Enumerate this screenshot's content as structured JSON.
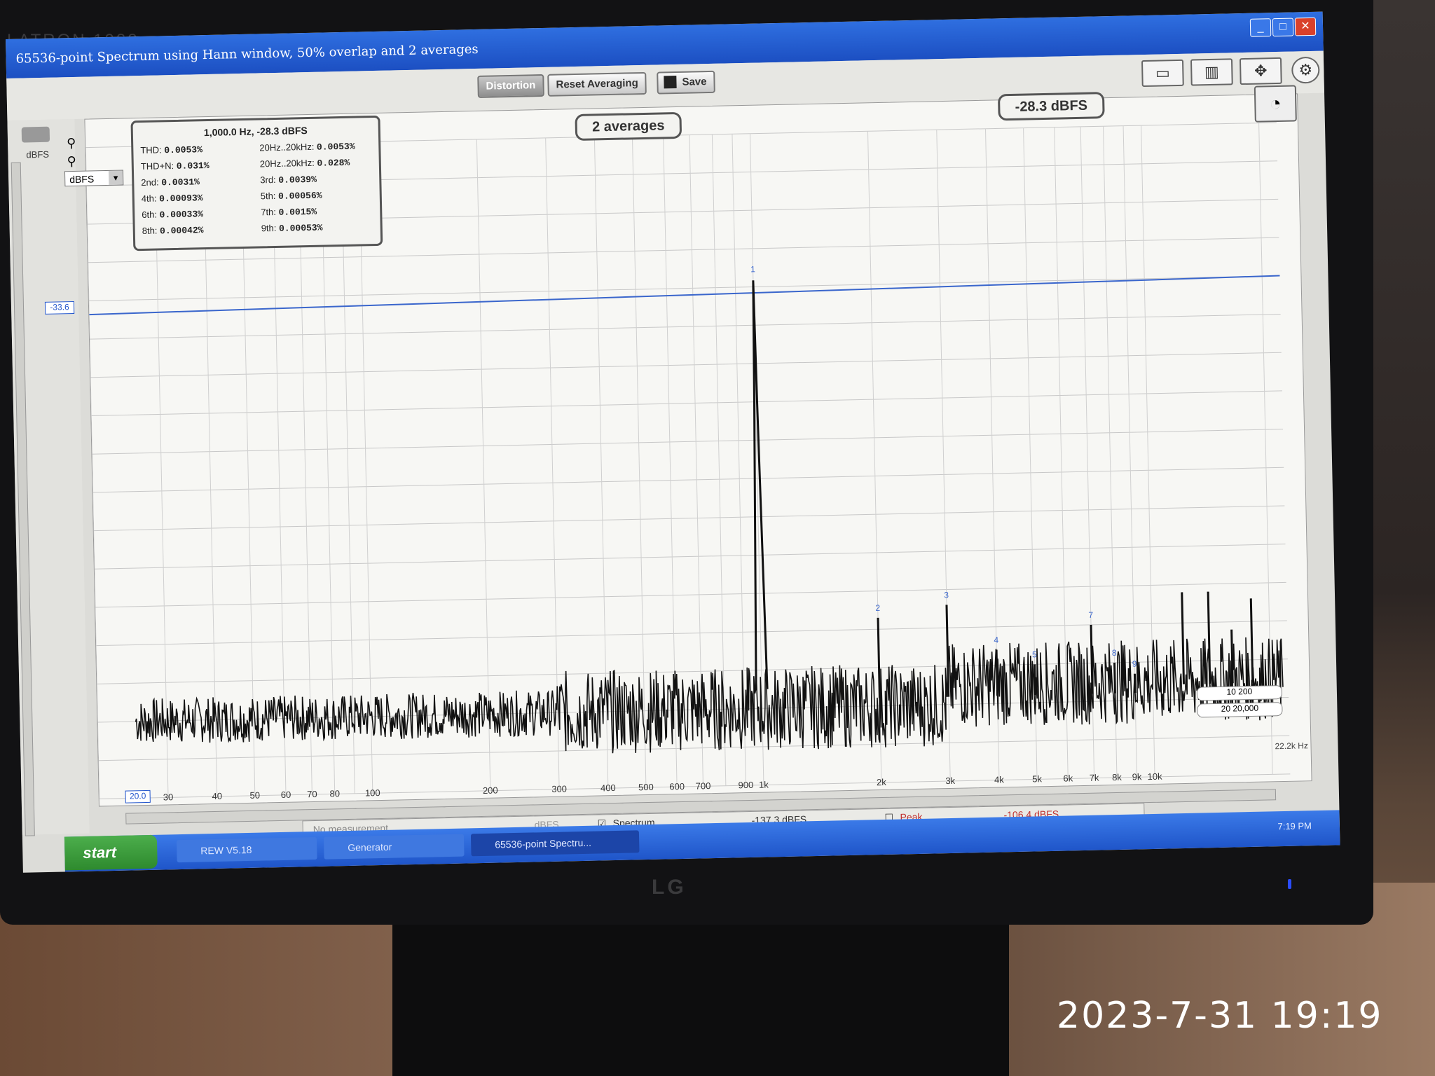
{
  "window": {
    "title": "65536-point Spectrum using Hann window, 50% overlap and 2 averages",
    "controls": [
      "_",
      "□",
      "✕"
    ]
  },
  "toolbar": {
    "distortion_label": "Distortion",
    "reset_label": "Reset Averaging",
    "save_label": "Save"
  },
  "unit_select": "dBFS",
  "axis_unit": "dBFS",
  "cursor_value": "-33.6",
  "freq_start": "20.0",
  "freq_end": "22.2k Hz",
  "info": {
    "header": "1,000.0 Hz, -28.3 dBFS",
    "rows": [
      {
        "l": "THD:",
        "lv": "0.0053%",
        "r": "20Hz..20kHz:",
        "rv": "0.0053%"
      },
      {
        "l": "THD+N:",
        "lv": "0.031%",
        "r": "20Hz..20kHz:",
        "rv": "0.028%"
      },
      {
        "l": "2nd:",
        "lv": "0.0031%",
        "r": "3rd:",
        "rv": "0.0039%"
      },
      {
        "l": "4th:",
        "lv": "0.00093%",
        "r": "5th:",
        "rv": "0.00056%"
      },
      {
        "l": "6th:",
        "lv": "0.00033%",
        "r": "7th:",
        "rv": "0.0015%"
      },
      {
        "l": "8th:",
        "lv": "0.00042%",
        "r": "9th:",
        "rv": "0.00053%"
      }
    ]
  },
  "averages_label": "2 averages",
  "level_label": "-28.3 dBFS",
  "range_buttons": [
    "10   200",
    "20   20,000"
  ],
  "legend": {
    "measurement": "No measurement",
    "unit": "dBFS",
    "spectrum_label": "Spectrum",
    "spectrum_value": "-137.3 dBFS",
    "peak_label": "Peak",
    "peak_value": "-106.4 dBFS"
  },
  "taskbar": {
    "start": "start",
    "items": [
      "REW V5.18",
      "Generator",
      "65536-point Spectru..."
    ],
    "clock": "7:19 PM"
  },
  "monitor": {
    "brand_top": "LATRON 1988",
    "brand": "LG"
  },
  "photo_timestamp": "2023-7-31 19:19",
  "chart_data": {
    "type": "line",
    "xscale": "log",
    "xlim": [
      20,
      22200
    ],
    "ylim": [
      -160,
      10
    ],
    "yticks": [
      10,
      0,
      -10,
      -20,
      -30,
      -40,
      -50,
      -60,
      -70,
      -80,
      -90,
      -100,
      -110,
      -120,
      -130,
      -140,
      -150,
      -160
    ],
    "xticks": [
      {
        "v": 30,
        "t": "30"
      },
      {
        "v": 40,
        "t": "40"
      },
      {
        "v": 50,
        "t": "50"
      },
      {
        "v": 60,
        "t": "60"
      },
      {
        "v": 70,
        "t": "70"
      },
      {
        "v": 80,
        "t": "80"
      },
      {
        "v": 100,
        "t": "100"
      },
      {
        "v": 200,
        "t": "200"
      },
      {
        "v": 300,
        "t": "300"
      },
      {
        "v": 400,
        "t": "400"
      },
      {
        "v": 500,
        "t": "500"
      },
      {
        "v": 600,
        "t": "600"
      },
      {
        "v": 700,
        "t": "700"
      },
      {
        "v": 900,
        "t": "900"
      },
      {
        "v": 1000,
        "t": "1k"
      },
      {
        "v": 2000,
        "t": "2k"
      },
      {
        "v": 3000,
        "t": "3k"
      },
      {
        "v": 4000,
        "t": "4k"
      },
      {
        "v": 5000,
        "t": "5k"
      },
      {
        "v": 6000,
        "t": "6k"
      },
      {
        "v": 7000,
        "t": "7k"
      },
      {
        "v": 8000,
        "t": "8k"
      },
      {
        "v": 9000,
        "t": "9k"
      },
      {
        "v": 10000,
        "t": "10k"
      }
    ],
    "cursor_line_dbfs": -33.6,
    "fundamental": {
      "x": 1000,
      "y": -28.3,
      "label": "1"
    },
    "harmonics": [
      {
        "x": 2000,
        "y": -117,
        "label": "2"
      },
      {
        "x": 3000,
        "y": -114,
        "label": "3"
      },
      {
        "x": 4000,
        "y": -126,
        "label": "4"
      },
      {
        "x": 5000,
        "y": -130,
        "label": "5"
      },
      {
        "x": 7000,
        "y": -120,
        "label": "7"
      },
      {
        "x": 8000,
        "y": -130,
        "label": "8"
      },
      {
        "x": 9000,
        "y": -133,
        "label": "9"
      }
    ],
    "spurs": [
      {
        "x": 12000,
        "y": -112
      },
      {
        "x": 14000,
        "y": -112
      },
      {
        "x": 16000,
        "y": -122
      },
      {
        "x": 18000,
        "y": -114
      }
    ],
    "noise_floor_dbfs": -140
  }
}
